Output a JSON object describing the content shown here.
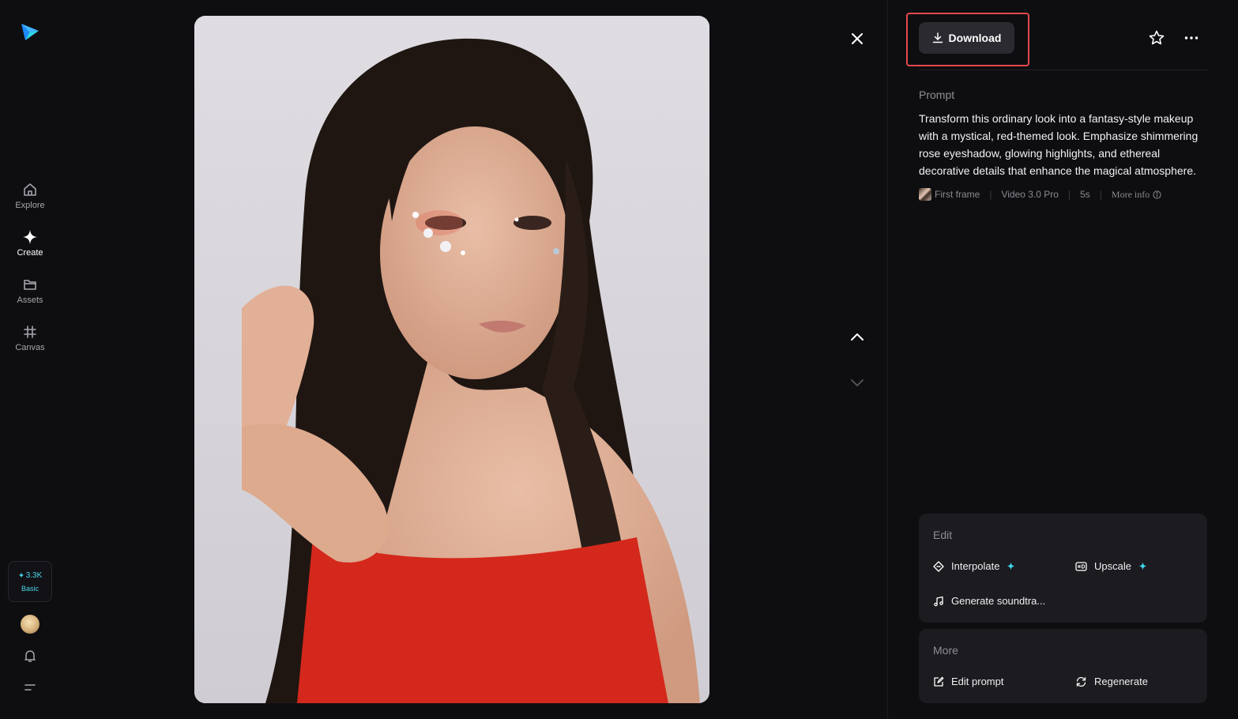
{
  "sidebar": {
    "logo_icon": "paper-plane-logo",
    "items": [
      {
        "label": "Explore",
        "icon": "home-icon"
      },
      {
        "label": "Create",
        "icon": "sparkle-icon",
        "active": true
      },
      {
        "label": "Assets",
        "icon": "folder-icon"
      },
      {
        "label": "Canvas",
        "icon": "canvas-icon"
      }
    ],
    "credits": {
      "value": "3.3K",
      "plan": "Basic"
    },
    "accent_color": "#4ad6e8"
  },
  "toolbar": {
    "download_label": "Download",
    "highlight_color": "#e5484d"
  },
  "prompt": {
    "heading": "Prompt",
    "text": "Transform this ordinary look into a fantasy-style makeup with a mystical, red-themed look. Emphasize shimmering rose eyeshadow, glowing highlights, and ethereal decorative details that enhance the magical atmosphere.",
    "meta": {
      "first_frame": "First frame",
      "model": "Video 3.0 Pro",
      "duration": "5s",
      "more_info": "More info"
    }
  },
  "edit_card": {
    "title": "Edit",
    "actions": {
      "interpolate": "Interpolate",
      "upscale": "Upscale",
      "soundtrack": "Generate soundtra..."
    }
  },
  "more_card": {
    "title": "More",
    "actions": {
      "edit_prompt": "Edit prompt",
      "regenerate": "Regenerate"
    }
  }
}
